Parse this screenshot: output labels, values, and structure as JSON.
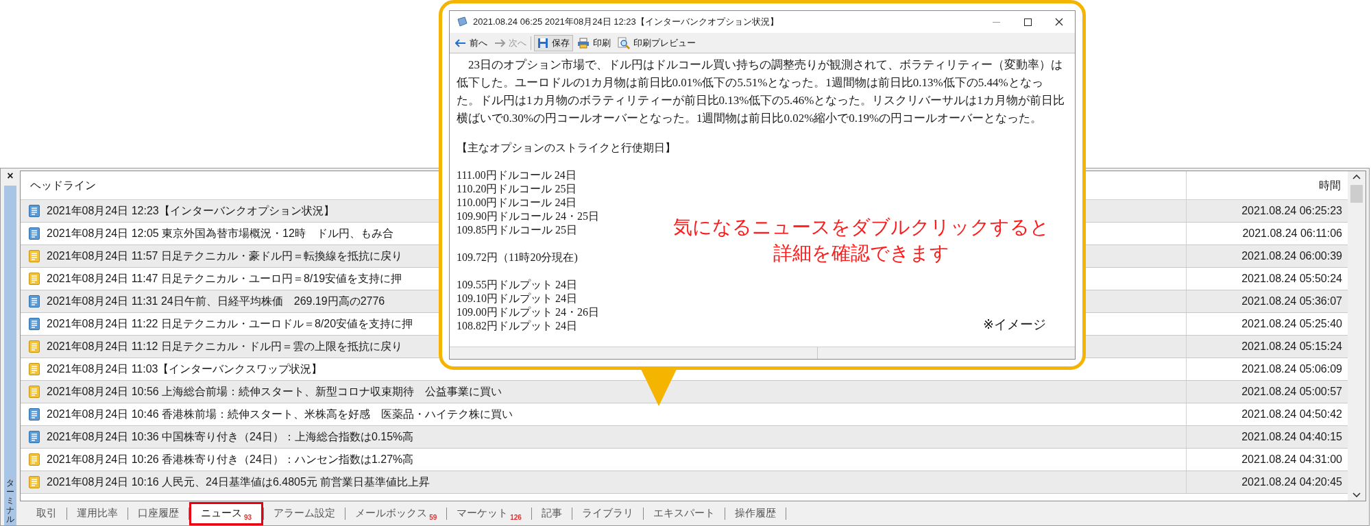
{
  "terminal": {
    "side_label": "ターミナル",
    "close": "×",
    "columns": [
      "ヘッドライン",
      "時間"
    ],
    "rows": [
      {
        "kind": "blue",
        "headline": "2021年08月24日 12:23【インターバンクオプション状況】",
        "time": "2021.08.24 06:25:23"
      },
      {
        "kind": "blue",
        "headline": "2021年08月24日 12:05 東京外国為替市場概況・12時　ドル円、もみ合",
        "time": "2021.08.24 06:11:06"
      },
      {
        "kind": "yellow",
        "headline": "2021年08月24日 11:57 日足テクニカル・豪ドル円＝転換線を抵抗に戻り",
        "time": "2021.08.24 06:00:39"
      },
      {
        "kind": "yellow",
        "headline": "2021年08月24日 11:47 日足テクニカル・ユーロ円＝8/19安値を支持に押",
        "time": "2021.08.24 05:50:24"
      },
      {
        "kind": "blue",
        "headline": "2021年08月24日 11:31 24日午前、日経平均株価　269.19円高の2776",
        "time": "2021.08.24 05:36:07"
      },
      {
        "kind": "blue",
        "headline": "2021年08月24日 11:22 日足テクニカル・ユーロドル＝8/20安値を支持に押",
        "time": "2021.08.24 05:25:40"
      },
      {
        "kind": "yellow",
        "headline": "2021年08月24日 11:12 日足テクニカル・ドル円＝雲の上限を抵抗に戻り",
        "time": "2021.08.24 05:15:24"
      },
      {
        "kind": "yellow",
        "headline": "2021年08月24日 11:03【インターバンクスワップ状況】",
        "time": "2021.08.24 05:06:09"
      },
      {
        "kind": "yellow",
        "headline": "2021年08月24日 10:56 上海総合前場：続伸スタート、新型コロナ収束期待　公益事業に買い",
        "time": "2021.08.24 05:00:57"
      },
      {
        "kind": "blue",
        "headline": "2021年08月24日 10:46 香港株前場：続伸スタート、米株高を好感　医薬品・ハイテク株に買い",
        "time": "2021.08.24 04:50:42"
      },
      {
        "kind": "blue",
        "headline": "2021年08月24日 10:36 中国株寄り付き（24日）：上海総合指数は0.15%高",
        "time": "2021.08.24 04:40:15"
      },
      {
        "kind": "yellow",
        "headline": "2021年08月24日 10:26 香港株寄り付き（24日）：ハンセン指数は1.27%高",
        "time": "2021.08.24 04:31:00"
      },
      {
        "kind": "yellow",
        "headline": "2021年08月24日 10:16 人民元、24日基準値は6.4805元 前営業日基準値比上昇",
        "time": "2021.08.24 04:20:45"
      }
    ],
    "tabs": [
      {
        "label": "取引",
        "selected": false
      },
      {
        "label": "運用比率",
        "selected": false
      },
      {
        "label": "口座履歴",
        "selected": false
      },
      {
        "label": "ニュース",
        "count": "93",
        "selected": true
      },
      {
        "label": "アラーム設定",
        "selected": false
      },
      {
        "label": "メールボックス",
        "count": "59",
        "selected": false
      },
      {
        "label": "マーケット",
        "count": "126",
        "selected": false
      },
      {
        "label": "記事",
        "selected": false
      },
      {
        "label": "ライブラリ",
        "selected": false
      },
      {
        "label": "エキスパート",
        "selected": false
      },
      {
        "label": "操作履歴",
        "selected": false
      }
    ]
  },
  "popup": {
    "window_title": "2021.08.24 06:25 2021年08月24日 12:23【インターバンクオプション状況】",
    "toolbar": [
      {
        "kind": "back",
        "label": "前へ",
        "disabled": false
      },
      {
        "kind": "forward",
        "label": "次へ",
        "disabled": true
      },
      {
        "kind": "save",
        "label": "保存",
        "disabled": false
      },
      {
        "kind": "print",
        "label": "印刷",
        "disabled": false
      },
      {
        "kind": "preview",
        "label": "印刷プレビュー",
        "disabled": false
      }
    ],
    "paragraph": "　23日のオプション市場で、ドル円はドルコール買い持ちの調整売りが観測されて、ボラティリティー（変動率）は低下した。ユーロドルの1カ月物は前日比0.01%低下の5.51%となった。1週間物は前日比0.13%低下の5.44%となった。ドル円は1カ月物のボラティリティーが前日比0.13%低下の5.46%となった。リスクリバーサルは1カ月物が前日比横ばいで0.30%の円コールオーバーとなった。1週間物は前日比0.02%縮小で0.19%の円コールオーバーとなった。",
    "blocks": [
      [
        "【主なオプションのストライクと行使期日】"
      ],
      [
        "111.00円ドルコール 24日",
        "110.20円ドルコール 25日",
        "110.00円ドルコール 24日",
        "109.90円ドルコール 24・25日",
        "109.85円ドルコール 25日"
      ],
      [
        "109.72円（11時20分現在)"
      ],
      [
        "109.55円ドルプット 24日",
        "109.10円ドルプット 24日",
        "109.00円ドルプット 24・26日",
        "108.82円ドルプット 24日"
      ]
    ],
    "callout": [
      "気になるニュースをダブルクリックすると",
      "詳細を確認できます"
    ],
    "note": "※イメージ"
  }
}
